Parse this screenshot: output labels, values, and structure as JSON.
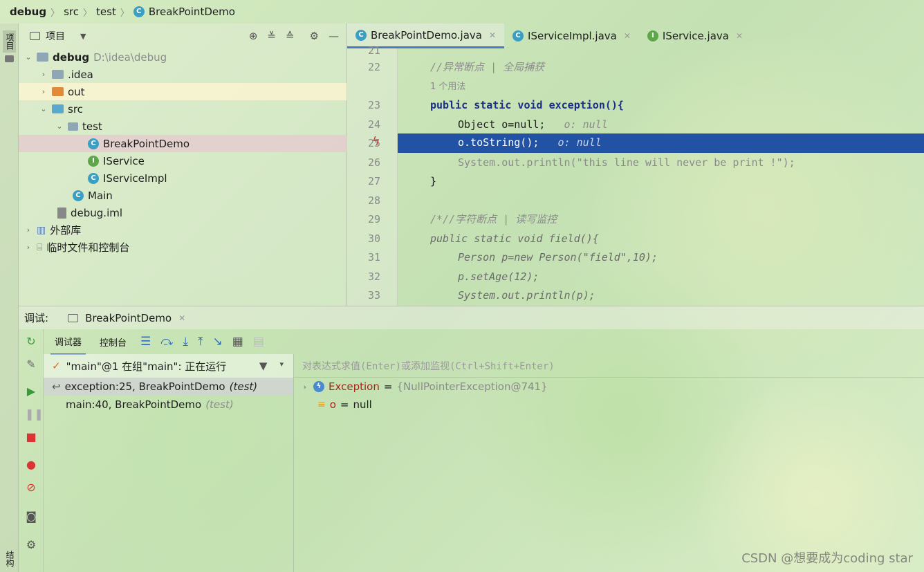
{
  "breadcrumb": {
    "items": [
      "debug",
      "src",
      "test",
      "BreakPointDemo"
    ]
  },
  "left_strip": {
    "top_tab": "项目",
    "bottom_tab": "结构"
  },
  "project_panel": {
    "title": "项目",
    "tree": [
      {
        "label": "debug",
        "path": "D:\\idea\\debug"
      },
      {
        "label": ".idea"
      },
      {
        "label": "out"
      },
      {
        "label": "src"
      },
      {
        "label": "test"
      },
      {
        "label": "BreakPointDemo"
      },
      {
        "label": "IService"
      },
      {
        "label": "IServiceImpl"
      },
      {
        "label": "Main"
      },
      {
        "label": "debug.iml"
      },
      {
        "label": "外部库"
      },
      {
        "label": "临时文件和控制台"
      }
    ]
  },
  "editor": {
    "tabs": [
      "BreakPointDemo.java",
      "IServiceImpl.java",
      "IService.java"
    ],
    "usage_hint": "1 个用法",
    "lines": [
      {
        "num": "21",
        "text": ""
      },
      {
        "num": "22",
        "text": "//异常断点 | 全局捕获"
      },
      {
        "num": "23",
        "text": "public static void exception(){"
      },
      {
        "num": "24",
        "text": "Object o=null;",
        "hint": "o: null"
      },
      {
        "num": "25",
        "text": "o.toString();",
        "hint": "o: null"
      },
      {
        "num": "26",
        "text": "System.out.println(\"this line will never be print !\");"
      },
      {
        "num": "27",
        "text": "}"
      },
      {
        "num": "28",
        "text": ""
      },
      {
        "num": "29",
        "text": "/*//字符断点 | 读写监控"
      },
      {
        "num": "30",
        "text": "public static void field(){"
      },
      {
        "num": "31",
        "text": "Person p=new Person(\"field\",10);"
      },
      {
        "num": "32",
        "text": "p.setAge(12);"
      },
      {
        "num": "33",
        "text": "System.out.println(p);"
      }
    ]
  },
  "debug": {
    "label": "调试:",
    "session": "BreakPointDemo",
    "tabs": [
      "调试器",
      "控制台"
    ],
    "thread": "\"main\"@1 在组\"main\": 正在运行",
    "frames": [
      {
        "method": "exception:25, BreakPointDemo",
        "pkg": "(test)"
      },
      {
        "method": "main:40, BreakPointDemo",
        "pkg": "(test)"
      }
    ],
    "eval_placeholder": "对表达式求值(Enter)或添加监视(Ctrl+Shift+Enter)",
    "variables": [
      {
        "name": "Exception",
        "eq": "=",
        "value": "{NullPointerException@741}"
      },
      {
        "name": "o",
        "eq": "=",
        "value": "null"
      }
    ]
  },
  "watermark": "CSDN @想要成为coding star"
}
